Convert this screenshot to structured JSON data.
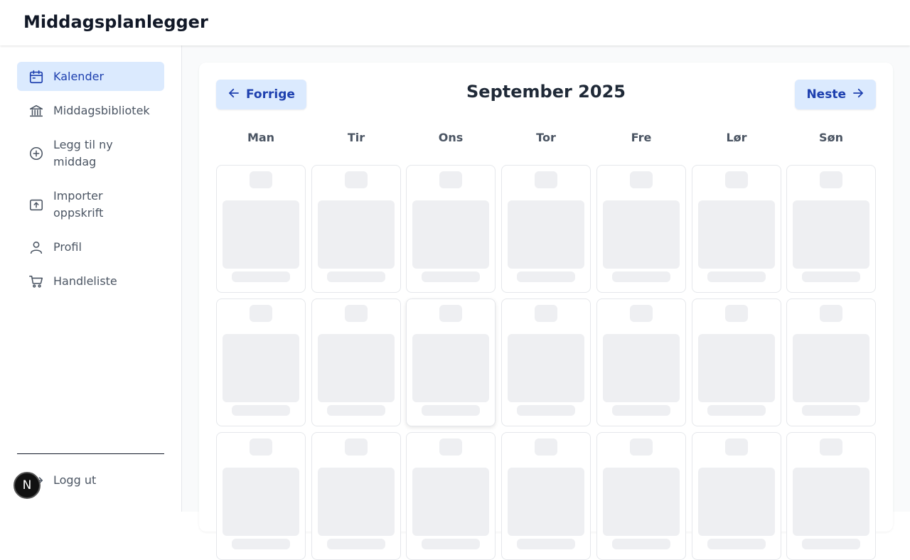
{
  "app": {
    "title": "Middagsplanlegger"
  },
  "sidebar": {
    "items": [
      {
        "label": "Kalender",
        "icon": "calendar-icon",
        "active": true
      },
      {
        "label": "Middagsbibliotek",
        "icon": "library-icon"
      },
      {
        "label": "Legg til ny middag",
        "icon": "plus-circle-icon"
      },
      {
        "label": "Importer oppskrift",
        "icon": "upload-icon"
      },
      {
        "label": "Profil",
        "icon": "user-icon"
      },
      {
        "label": "Handleliste",
        "icon": "cart-icon"
      }
    ],
    "logout": {
      "label": "Logg ut",
      "icon": "logout-icon"
    },
    "avatar_initial": "N"
  },
  "calendar": {
    "title": "September 2025",
    "prev_label": "Forrige",
    "next_label": "Neste",
    "weekdays": [
      "Man",
      "Tir",
      "Ons",
      "Tor",
      "Fre",
      "Lør",
      "Søn"
    ],
    "state": "loading"
  },
  "colors": {
    "accent": "#1e40af",
    "accent_bg": "#dbeafe",
    "skeleton": "#eeeff2"
  }
}
